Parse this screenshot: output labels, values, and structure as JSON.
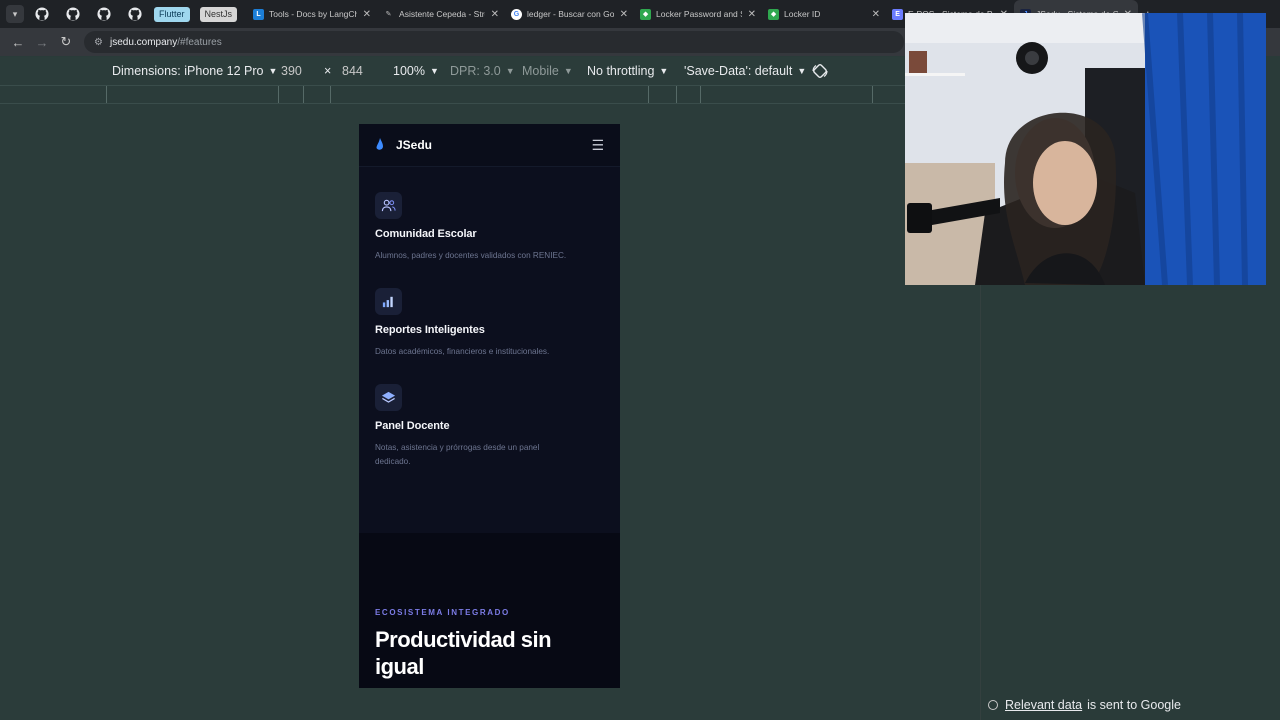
{
  "browser": {
    "tabs": [
      {
        "title": "Tools - Docs by LangCh",
        "favicon": "langchain-icon",
        "color": "#1c7ed6"
      },
      {
        "title": "Asistente Cepeda - Stre",
        "favicon": "feather-icon",
        "color": "#8a8a8a"
      },
      {
        "title": "ledger - Buscar con Go",
        "favicon": "google-icon",
        "color": "#4285f4"
      },
      {
        "title": "Locker Password and S",
        "favicon": "shield-icon",
        "color": "#2fa84f"
      },
      {
        "title": "Locker ID",
        "favicon": "shield-icon",
        "color": "#2fa84f"
      },
      {
        "title": "E-POS - Sistema de P",
        "favicon": "pos-icon",
        "color": "#6b7cff"
      },
      {
        "title": "JSedu - Sistema de G",
        "favicon": "jsedu-icon",
        "color": "#4a8cff"
      }
    ],
    "chips": [
      "Flutter",
      "NestJs"
    ],
    "url_host": "jsedu.company",
    "url_path": "/#features"
  },
  "devtools": {
    "dimensions_label": "Dimensions: iPhone 12 Pro",
    "width": "390",
    "times": "×",
    "height": "844",
    "zoom": "100%",
    "dpr": "DPR: 3.0",
    "mode": "Mobile",
    "throttling": "No throttling",
    "save_data": "'Save-Data': default"
  },
  "footer": {
    "link": "Relevant data",
    "text": "is sent to Google"
  },
  "app": {
    "brand": "JSedu",
    "features": [
      {
        "icon": "users-icon",
        "title": "Comunidad Escolar",
        "desc": "Alumnos, padres y docentes validados con RENIEC."
      },
      {
        "icon": "bar-chart-icon",
        "title": "Reportes Inteligentes",
        "desc": "Datos académicos, financieros e institucionales."
      },
      {
        "icon": "layers-icon",
        "title": "Panel Docente",
        "desc": "Notas, asistencia y prórrogas desde un panel dedicado."
      }
    ],
    "eco_eyebrow": "ECOSISTEMA INTEGRADO",
    "eco_title": "Productividad sin igual"
  },
  "colors": {
    "accent": "#7c7ce6",
    "phone_bg": "#0c0f1e",
    "page_bg": "#2b3c3a"
  }
}
